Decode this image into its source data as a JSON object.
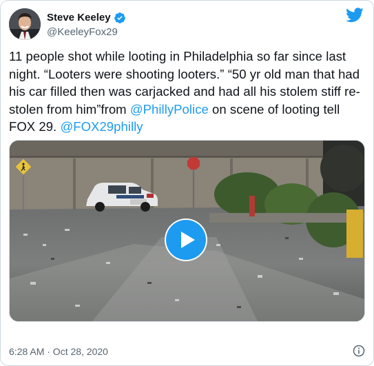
{
  "author": {
    "display_name": "Steve Keeley",
    "handle": "@KeeleyFox29"
  },
  "tweet": {
    "text_part1": "11 people shot while looting in Philadelphia so far since last night.  “Looters were shooting looters.”   “50 yr old man that had his car filled then was carjacked and had all his stolem stiff re-stolen from him”from ",
    "mention1": "@PhillyPolice",
    "text_part2": " on scene of looting tell FOX 29.  ",
    "mention2": "@FOX29philly"
  },
  "timestamp": "6:28 AM · Oct 28, 2020",
  "icons": {
    "verified": "verified-badge-icon",
    "brand": "twitter-bird-icon",
    "play": "play-icon",
    "info": "info-icon"
  },
  "colors": {
    "accent": "#1d9bf0",
    "text": "#0f1419",
    "secondary": "#536471"
  }
}
